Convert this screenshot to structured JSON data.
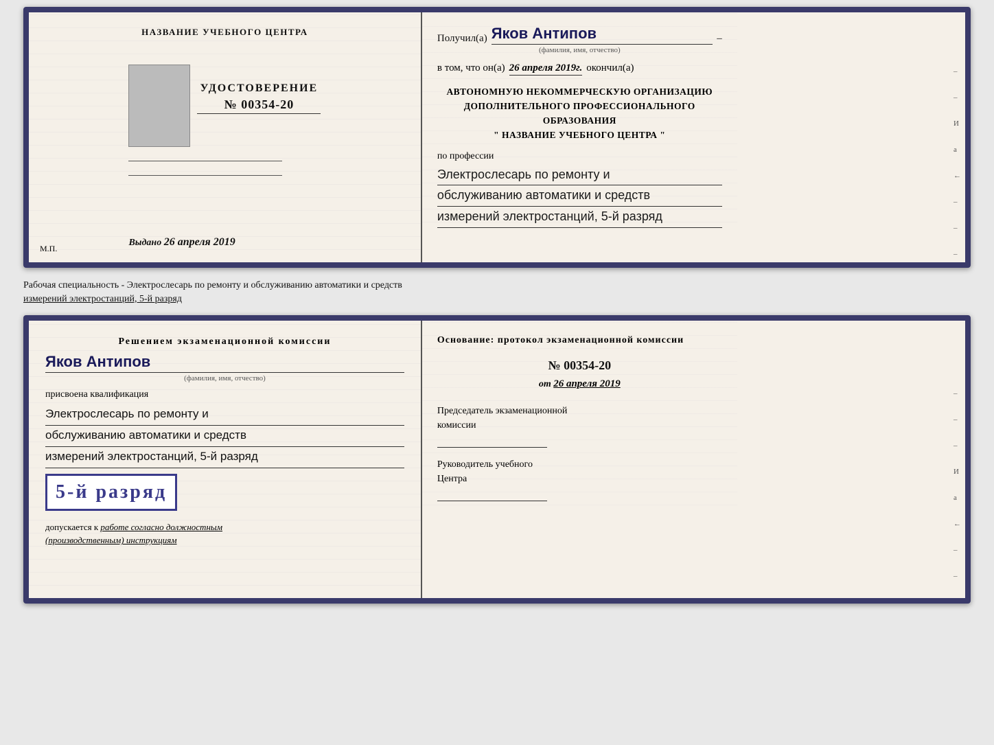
{
  "top_doc": {
    "left": {
      "org_name": "НАЗВАНИЕ УЧЕБНОГО ЦЕНТРА",
      "cert_label": "УДОСТОВЕРЕНИЕ",
      "cert_number": "№ 00354-20",
      "issued_label": "Выдано",
      "issued_date": "26 апреля 2019",
      "mp_label": "М.П."
    },
    "right": {
      "recv_prefix": "Получил(а)",
      "recv_name": "Яков Антипов",
      "name_subtitle": "(фамилия, имя, отчество)",
      "in_that_prefix": "в том, что он(а)",
      "in_that_date": "26 апреля 2019г.",
      "finished_label": "окончил(а)",
      "org_block_line1": "АВТОНОМНУЮ НЕКОММЕРЧЕСКУЮ ОРГАНИЗАЦИЮ",
      "org_block_line2": "ДОПОЛНИТЕЛЬНОГО ПРОФЕССИОНАЛЬНОГО ОБРАЗОВАНИЯ",
      "org_block_line3": "\"    НАЗВАНИЕ УЧЕБНОГО ЦЕНТРА    \"",
      "profession_label": "по профессии",
      "profession_line1": "Электрослесарь по ремонту и",
      "profession_line2": "обслуживанию автоматики и средств",
      "profession_line3": "измерений электростанций, 5-й разряд"
    }
  },
  "separator": {
    "text_line1": "Рабочая специальность - Электрослесарь по ремонту и обслуживанию автоматики и средств",
    "text_line2": "измерений электростанций, 5-й разряд"
  },
  "bottom_doc": {
    "left": {
      "decision_title": "Решением  экзаменационной  комиссии",
      "person_name": "Яков Антипов",
      "name_subtitle": "(фамилия, имя, отчество)",
      "qualification_label": "присвоена квалификация",
      "qual_line1": "Электрослесарь по ремонту и",
      "qual_line2": "обслуживанию автоматики и средств",
      "qual_line3": "измерений электростанций, 5-й разряд",
      "rank_badge": "5-й разряд",
      "allowed_prefix": "допускается к",
      "allowed_italic": "работе согласно должностным",
      "allowed_italic2": "(производственным) инструкциям"
    },
    "right": {
      "osnov_title": "Основание: протокол экзаменационной  комиссии",
      "protocol_number": "№  00354-20",
      "from_label": "от",
      "from_date": "26 апреля 2019",
      "chairman_label": "Председатель экзаменационной",
      "chairman_label2": "комиссии",
      "director_label": "Руководитель учебного",
      "director_label2": "Центра"
    }
  }
}
